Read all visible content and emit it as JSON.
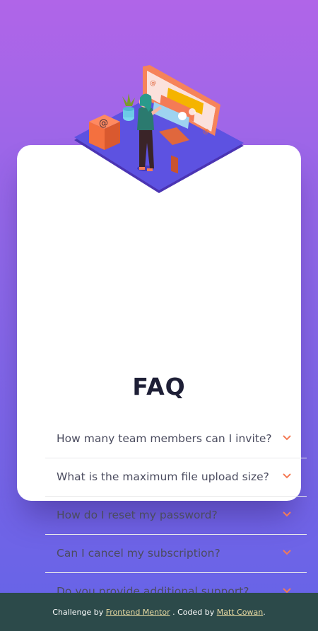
{
  "faq": {
    "title": "FAQ",
    "items": [
      {
        "question": "How many team members can I invite?"
      },
      {
        "question": "What is the maximum file upload size?"
      },
      {
        "question": "How do I reset my password?"
      },
      {
        "question": "Can I cancel my subscription?"
      },
      {
        "question": "Do you provide additional support?"
      }
    ],
    "icons": {
      "item": "chevron-down-icon",
      "illustration": "woman-at-online-desktop-illustration"
    }
  },
  "footer": {
    "prefix": "Challenge by",
    "link1": "Frontend Mentor",
    "middle": ". Coded by",
    "link2": "Matt Cowan",
    "suffix": "."
  },
  "colors": {
    "gradient_top": "#b065e8",
    "gradient_bottom": "#6463e7",
    "title": "#1e1f36",
    "question": "#4b4c5f",
    "chevron": "#f47b56",
    "footer_bg": "#2c4a4a",
    "footer_link": "#e7d9a1"
  }
}
